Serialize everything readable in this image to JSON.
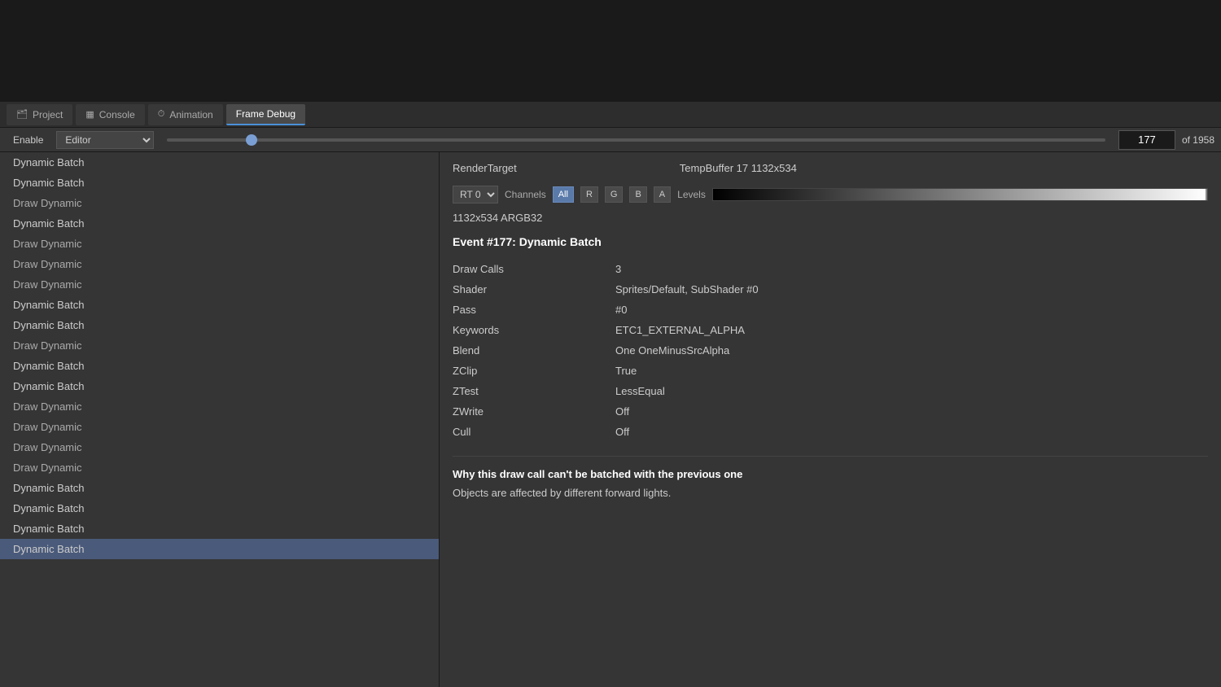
{
  "tabs": [
    {
      "label": "Project",
      "icon": "🗂",
      "active": false
    },
    {
      "label": "Console",
      "icon": "▦",
      "active": false
    },
    {
      "label": "Animation",
      "icon": "⏱",
      "active": false
    },
    {
      "label": "Frame Debug",
      "icon": "",
      "active": true
    }
  ],
  "toolbar": {
    "enable_label": "Enable",
    "editor_option": "Editor",
    "frame_number": "177",
    "of_total": "of 1958"
  },
  "list": {
    "items": [
      {
        "label": "Dynamic Batch",
        "type": "dynamic-batch"
      },
      {
        "label": "Dynamic Batch",
        "type": "dynamic-batch"
      },
      {
        "label": "Draw Dynamic",
        "type": "draw-dynamic"
      },
      {
        "label": "Dynamic Batch",
        "type": "dynamic-batch"
      },
      {
        "label": "Draw Dynamic",
        "type": "draw-dynamic"
      },
      {
        "label": "Draw Dynamic",
        "type": "draw-dynamic"
      },
      {
        "label": "Draw Dynamic",
        "type": "draw-dynamic"
      },
      {
        "label": "Dynamic Batch",
        "type": "dynamic-batch"
      },
      {
        "label": "Dynamic Batch",
        "type": "dynamic-batch"
      },
      {
        "label": "Draw Dynamic",
        "type": "draw-dynamic"
      },
      {
        "label": "Dynamic Batch",
        "type": "dynamic-batch"
      },
      {
        "label": "Dynamic Batch",
        "type": "dynamic-batch"
      },
      {
        "label": "Draw Dynamic",
        "type": "draw-dynamic"
      },
      {
        "label": "Draw Dynamic",
        "type": "draw-dynamic"
      },
      {
        "label": "Draw Dynamic",
        "type": "draw-dynamic"
      },
      {
        "label": "Draw Dynamic",
        "type": "draw-dynamic"
      },
      {
        "label": "Dynamic Batch",
        "type": "dynamic-batch"
      },
      {
        "label": "Dynamic Batch",
        "type": "dynamic-batch"
      },
      {
        "label": "Dynamic Batch",
        "type": "dynamic-batch"
      },
      {
        "label": "Dynamic Batch",
        "type": "dynamic-batch",
        "selected": true
      }
    ]
  },
  "detail": {
    "render_target_label": "RenderTarget",
    "render_target_value": "TempBuffer 17 1132x534",
    "rt_option": "RT 0",
    "channels_label": "Channels",
    "channel_buttons": [
      "All",
      "R",
      "G",
      "B",
      "A"
    ],
    "active_channel": "All",
    "levels_label": "Levels",
    "format_text": "1132x534 ARGB32",
    "event_title": "Event #177: Dynamic Batch",
    "properties": [
      {
        "key": "Draw Calls",
        "value": "3"
      },
      {
        "key": "Shader",
        "value": "Sprites/Default, SubShader #0"
      },
      {
        "key": "Pass",
        "value": "#0"
      },
      {
        "key": "Keywords",
        "value": "ETC1_EXTERNAL_ALPHA"
      },
      {
        "key": "Blend",
        "value": "One OneMinusSrcAlpha"
      },
      {
        "key": "ZClip",
        "value": "True"
      },
      {
        "key": "ZTest",
        "value": "LessEqual"
      },
      {
        "key": "ZWrite",
        "value": "Off"
      },
      {
        "key": "Cull",
        "value": "Off"
      }
    ],
    "batch_warning": "Why this draw call can't be batched with the previous one",
    "batch_reason": "Objects are affected by different forward lights."
  }
}
